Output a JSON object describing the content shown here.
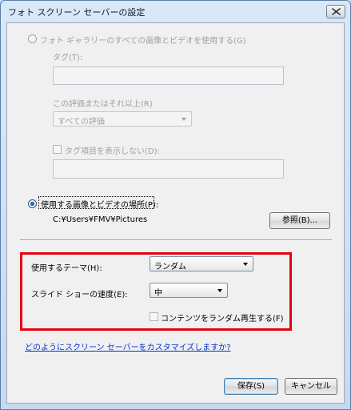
{
  "window": {
    "title": "フォト スクリーン セーバーの設定"
  },
  "option_all": {
    "label": "フォト ギャラリーのすべての画像とビデオを使用する(G)",
    "selected": false
  },
  "tag": {
    "label": "タグ(T):",
    "value": ""
  },
  "rating": {
    "label": "この評価またはそれ以上(R)",
    "value": "すべての評価"
  },
  "hide_tags": {
    "label": "タグ項目を表示しない(D):",
    "checked": false,
    "value": ""
  },
  "option_folder": {
    "label": "使用する画像とビデオの場所(P):",
    "selected": true,
    "path": "C:¥Users¥FMV¥Pictures"
  },
  "browse_button": "参照(B)...",
  "theme": {
    "label": "使用するテーマ(H):",
    "value": "ランダム"
  },
  "speed": {
    "label": "スライド ショーの速度(E):",
    "value": "中"
  },
  "shuffle": {
    "label": "コンテンツをランダム再生する(F)",
    "checked": false
  },
  "help_link": "どのようにスクリーン セーバーをカスタマイズしますか?",
  "save_button": "保存(S)",
  "cancel_button": "キャンセル",
  "colors": {
    "highlight": "#e60012",
    "link": "#0033cc"
  }
}
